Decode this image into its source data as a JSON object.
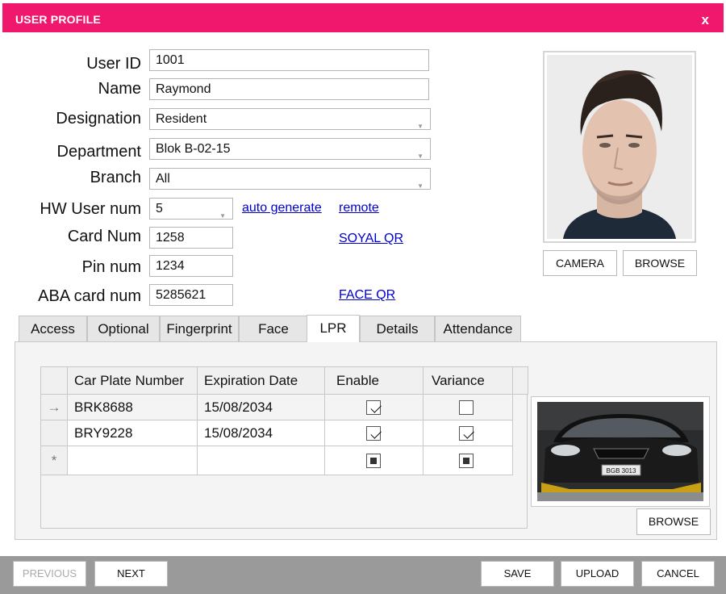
{
  "window": {
    "title": "USER PROFILE",
    "close_label": "x"
  },
  "form": {
    "user_id": {
      "label": "User ID",
      "value": "1001"
    },
    "name": {
      "label": "Name",
      "value": "Raymond"
    },
    "designation": {
      "label": "Designation",
      "value": "Resident"
    },
    "department": {
      "label": "Department",
      "value": "Blok B-02-15"
    },
    "branch": {
      "label": "Branch",
      "value": "All"
    },
    "hw_user_num": {
      "label": "HW User num",
      "value": "5"
    },
    "card_num": {
      "label": "Card Num",
      "value": "1258"
    },
    "pin_num": {
      "label": "Pin num",
      "value": "1234"
    },
    "aba_card_num": {
      "label": "ABA card num",
      "value": "5285621"
    }
  },
  "links": {
    "auto_generate": "auto generate",
    "remote": "remote",
    "soyal_qr": "SOYAL QR",
    "face_qr": "FACE QR"
  },
  "photo_buttons": {
    "camera": "CAMERA",
    "browse": "BROWSE"
  },
  "tabs": [
    {
      "label": "Access",
      "active": false
    },
    {
      "label": "Optional",
      "active": false
    },
    {
      "label": "Fingerprint",
      "active": false
    },
    {
      "label": "Face",
      "active": false
    },
    {
      "label": "LPR",
      "active": true
    },
    {
      "label": "Details",
      "active": false
    },
    {
      "label": "Attendance",
      "active": false
    }
  ],
  "lpr_table": {
    "columns": [
      "Car Plate Number",
      "Expiration Date",
      "Enable",
      "Variance"
    ],
    "rows": [
      {
        "indicator": "→",
        "plate": "BRK8688",
        "expiry": "15/08/2034",
        "enable": true,
        "variance": false
      },
      {
        "indicator": "",
        "plate": "BRY9228",
        "expiry": "15/08/2034",
        "enable": true,
        "variance": true
      }
    ],
    "new_row_indicator": "*"
  },
  "car_image": {
    "plate_text": "BGB 3013",
    "browse": "BROWSE"
  },
  "footer": {
    "previous": "PREVIOUS",
    "next": "NEXT",
    "save": "SAVE",
    "upload": "UPLOAD",
    "cancel": "CANCEL"
  },
  "colors": {
    "titlebar": "#f0186d",
    "footer": "#9a9a9a",
    "link": "#0000cc"
  }
}
